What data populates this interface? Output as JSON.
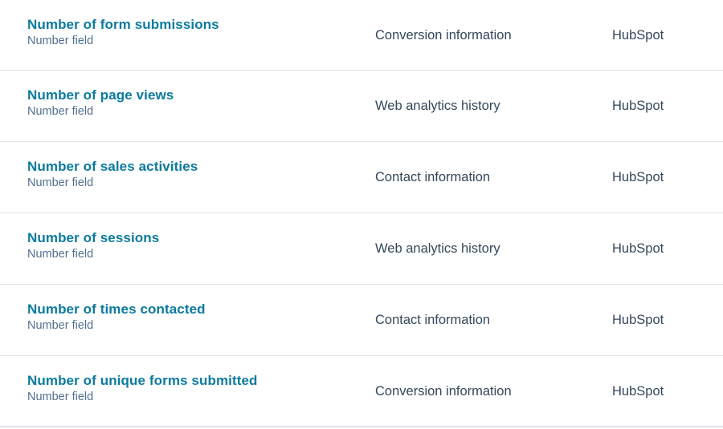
{
  "rows": [
    {
      "name": "Number of form submissions",
      "type": "Number field",
      "group": "Conversion information",
      "source": "HubSpot"
    },
    {
      "name": "Number of page views",
      "type": "Number field",
      "group": "Web analytics history",
      "source": "HubSpot"
    },
    {
      "name": "Number of sales activities",
      "type": "Number field",
      "group": "Contact information",
      "source": "HubSpot"
    },
    {
      "name": "Number of sessions",
      "type": "Number field",
      "group": "Web analytics history",
      "source": "HubSpot"
    },
    {
      "name": "Number of times contacted",
      "type": "Number field",
      "group": "Contact information",
      "source": "HubSpot"
    },
    {
      "name": "Number of unique forms submitted",
      "type": "Number field",
      "group": "Conversion information",
      "source": "HubSpot"
    }
  ],
  "colors": {
    "link": "#0b7a9e",
    "text": "#33475b",
    "subtext": "#516f90",
    "divider": "#dfe3eb"
  }
}
